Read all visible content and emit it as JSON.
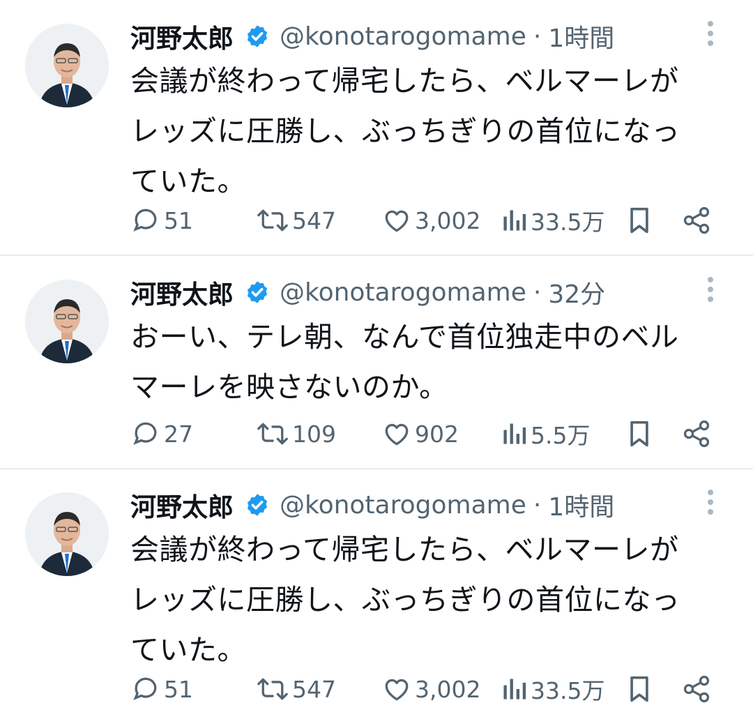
{
  "tweets": [
    {
      "name": "河野太郎",
      "handle": "@konotarogomame",
      "sep": "·",
      "time": "1時間",
      "lines": [
        "会議が終わって帰宅したら、ベルマーレが",
        "レッズに圧勝し、ぶっちぎりの首位になっ",
        "ていた。"
      ],
      "replies": "51",
      "retweets": "547",
      "likes": "3,002",
      "views": "33.5万"
    },
    {
      "name": "河野太郎",
      "handle": "@konotarogomame",
      "sep": "·",
      "time": "32分",
      "lines": [
        "おーい、テレ朝、なんで首位独走中のベル",
        "マーレを映さないのか。"
      ],
      "replies": "27",
      "retweets": "109",
      "likes": "902",
      "views": "5.5万"
    },
    {
      "name": "河野太郎",
      "handle": "@konotarogomame",
      "sep": "·",
      "time": "1時間",
      "lines": [
        "会議が終わって帰宅したら、ベルマーレが",
        "レッズに圧勝し、ぶっちぎりの首位になっ",
        "ていた。"
      ],
      "replies": "51",
      "retweets": "547",
      "likes": "3,002",
      "views": "33.5万"
    }
  ],
  "colors": {
    "verified": "#1d9bf0",
    "muted": "#536471",
    "text": "#0f1419",
    "divider": "#e6ecf0"
  },
  "icons": [
    "verified-badge-icon",
    "more-icon",
    "reply-icon",
    "retweet-icon",
    "like-icon",
    "views-icon",
    "bookmark-icon",
    "share-icon"
  ]
}
